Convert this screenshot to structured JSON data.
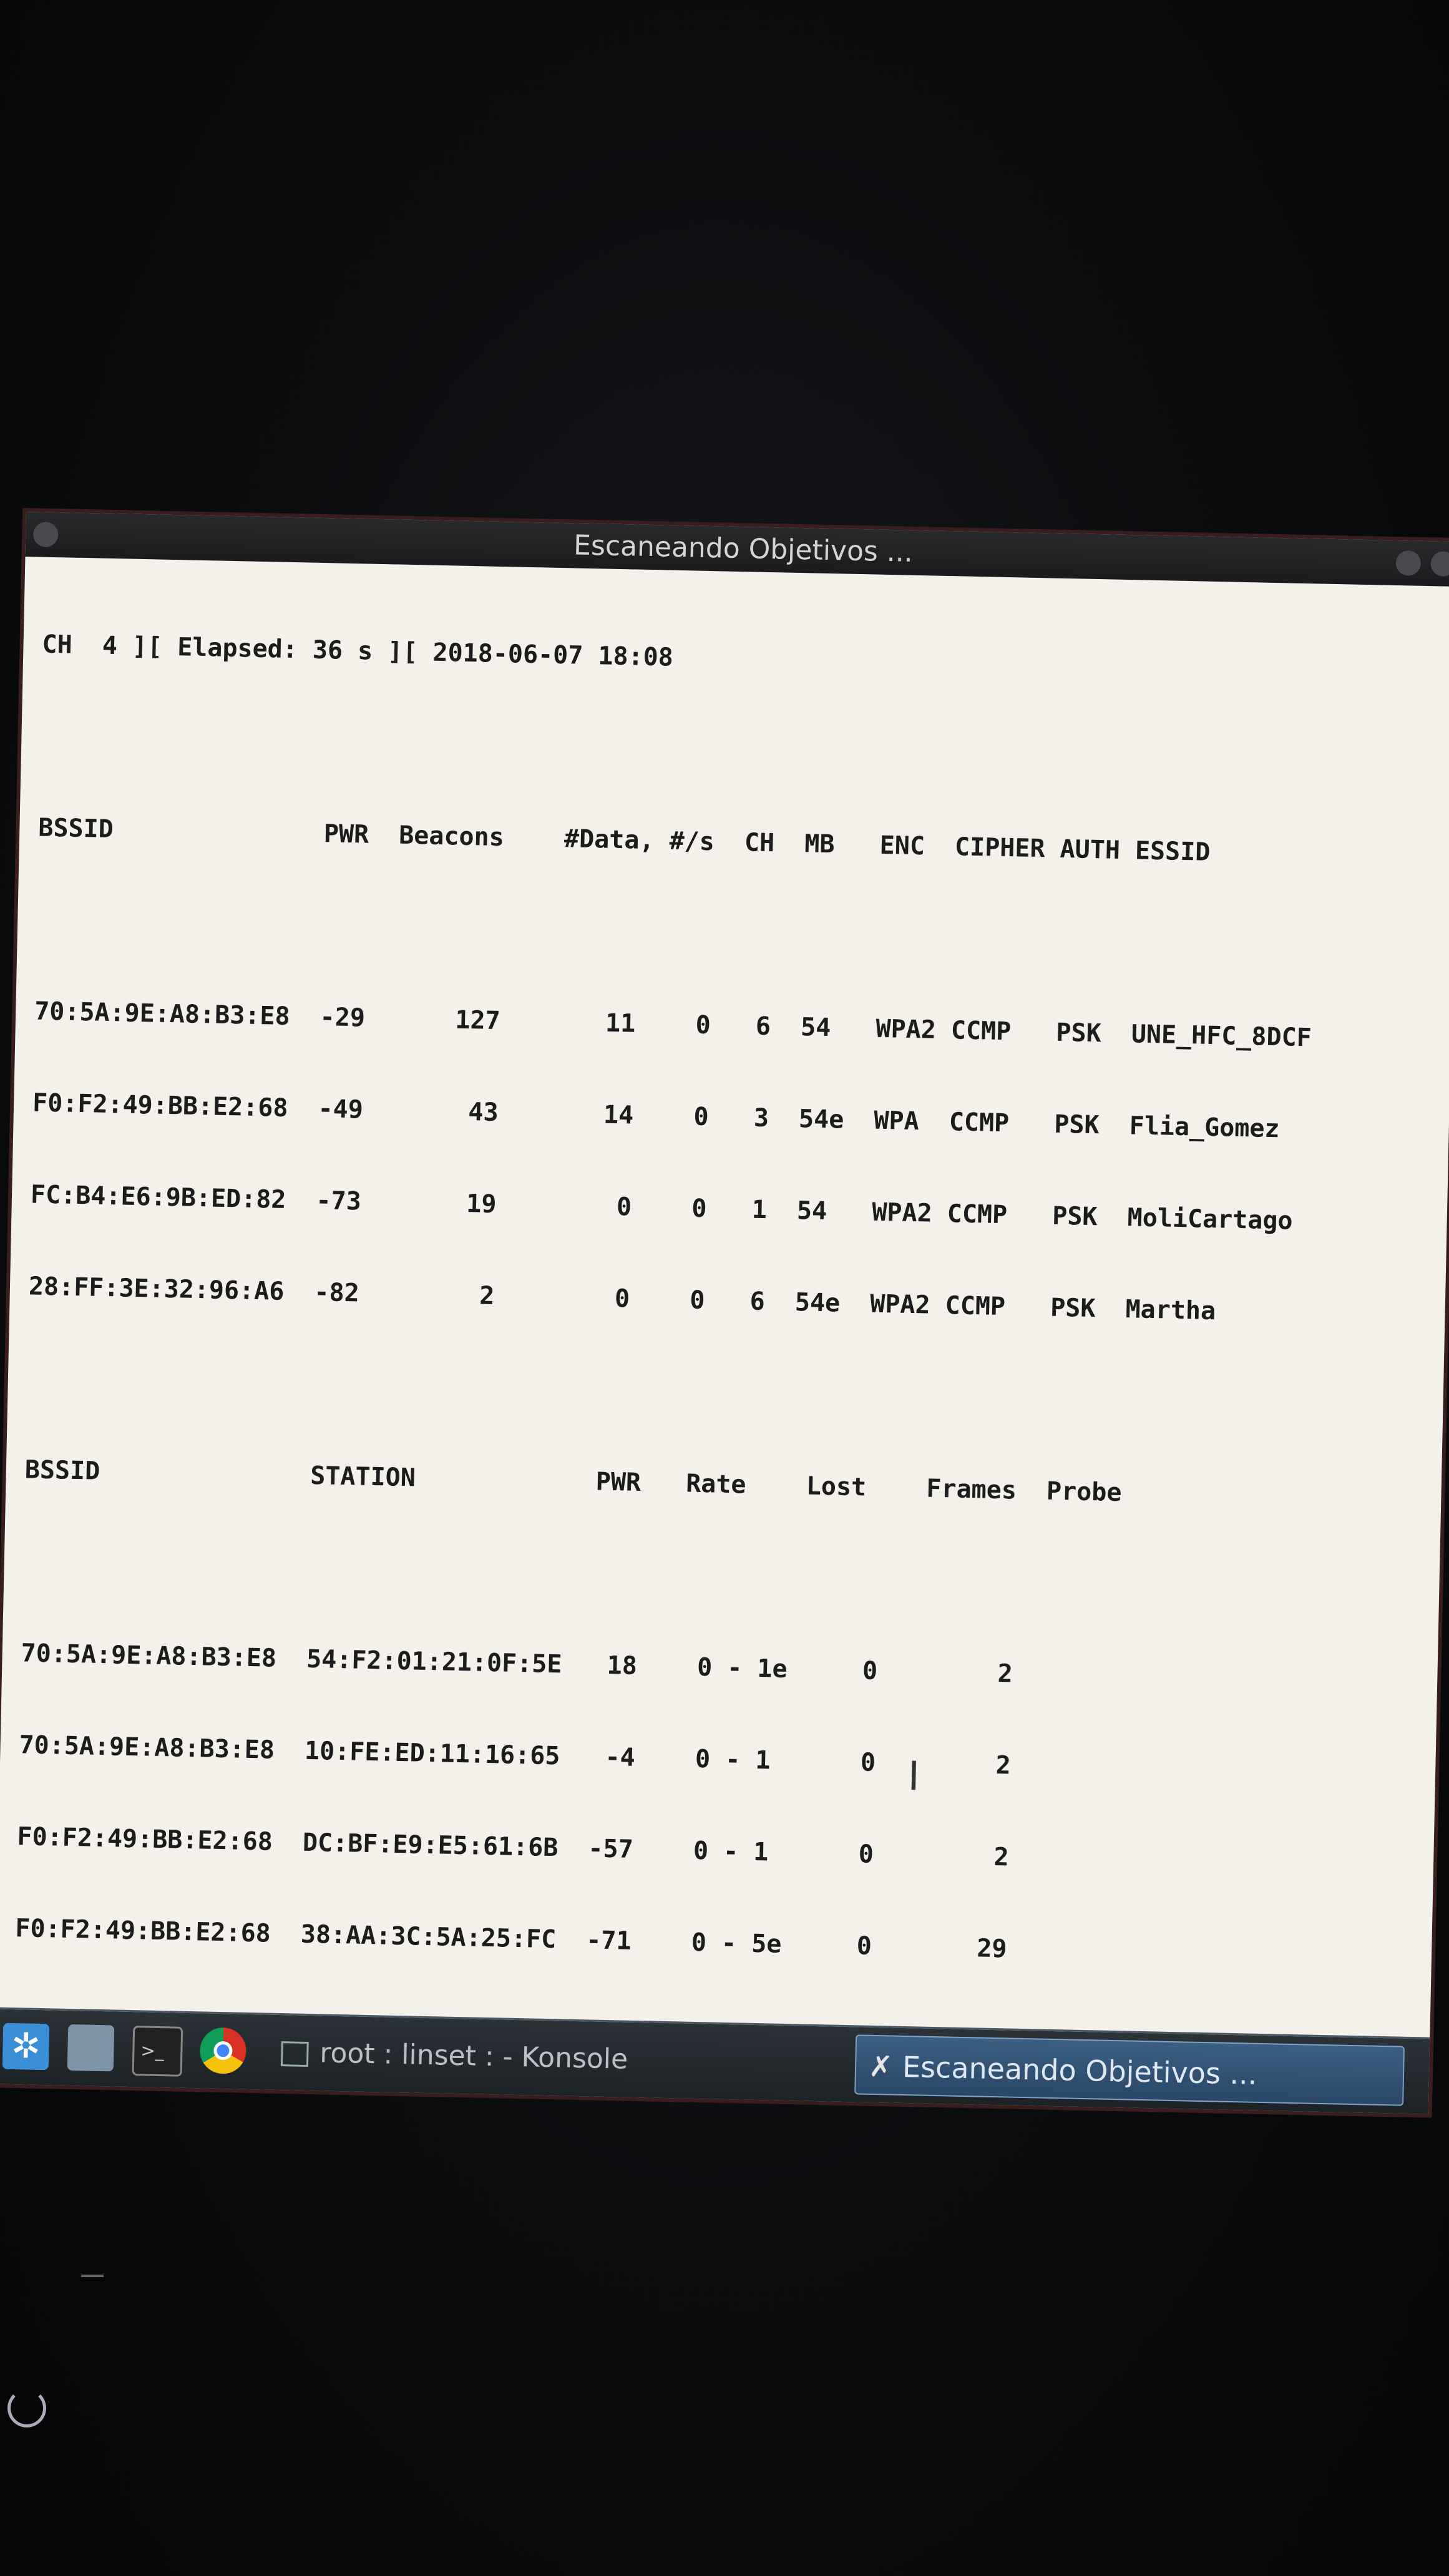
{
  "window": {
    "title": "Escaneando Objetivos ..."
  },
  "terminal": {
    "status_line": "CH  4 ][ Elapsed: 36 s ][ 2018-06-07 18:08",
    "ap_header": "BSSID              PWR  Beacons    #Data, #/s  CH  MB   ENC  CIPHER AUTH ESSID",
    "ap_rows": [
      "70:5A:9E:A8:B3:E8  -29      127       11    0   6  54   WPA2 CCMP   PSK  UNE_HFC_8DCF",
      "F0:F2:49:BB:E2:68  -49       43       14    0   3  54e  WPA  CCMP   PSK  Flia_Gomez",
      "FC:B4:E6:9B:ED:82  -73       19        0    0   1  54   WPA2 CCMP   PSK  MoliCartago",
      "28:FF:3E:32:96:A6  -82        2        0    0   6  54e  WPA2 CCMP   PSK  Martha"
    ],
    "sta_header": "BSSID              STATION            PWR   Rate    Lost    Frames  Probe",
    "sta_rows": [
      "70:5A:9E:A8:B3:E8  54:F2:01:21:0F:5E   18    0 - 1e     0        2",
      "70:5A:9E:A8:B3:E8  10:FE:ED:11:16:65   -4    0 - 1      0        2",
      "F0:F2:49:BB:E2:68  DC:BF:E9:E5:61:6B  -57    0 - 1      0        2",
      "F0:F2:49:BB:E2:68  38:AA:3C:5A:25:FC  -71    0 - 5e     0       29"
    ]
  },
  "taskbar": {
    "task_konsole": "root : linset :  - Konsole",
    "task_active": "Escaneando Objetivos ..."
  }
}
